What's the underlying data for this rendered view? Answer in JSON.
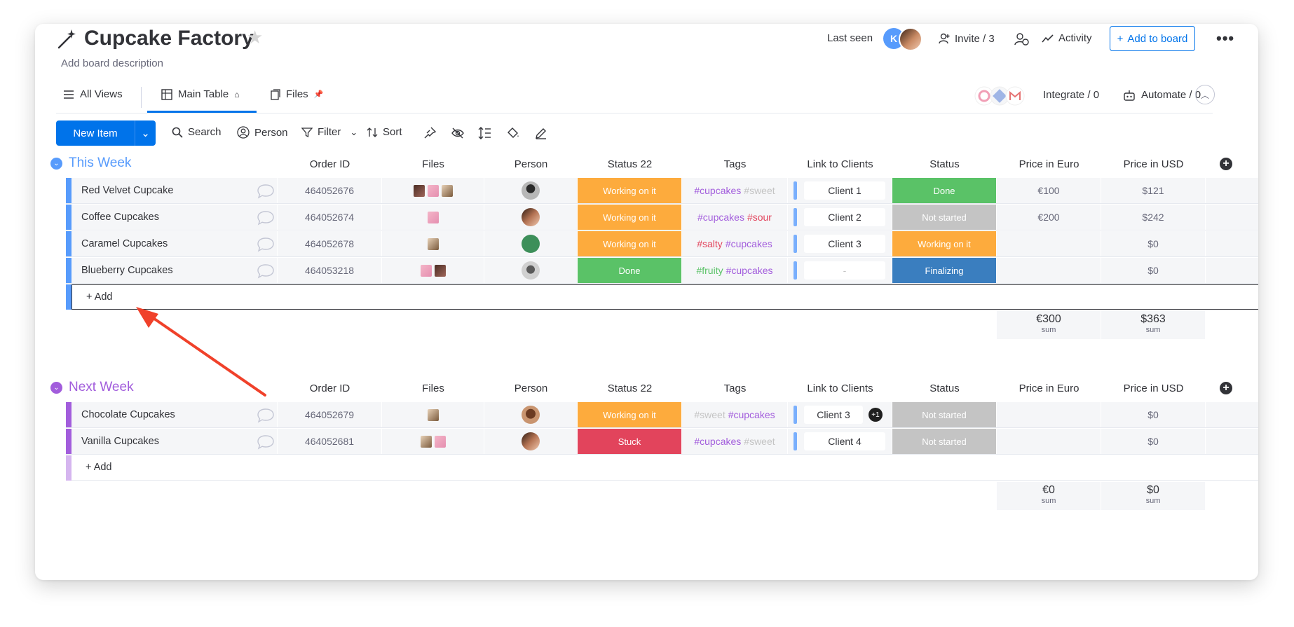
{
  "board": {
    "title": "Cupcake Factory",
    "description": "Add board description",
    "last_seen_label": "Last seen",
    "avatar_initial": "K",
    "invite_label": "Invite / 3",
    "activity_label": "Activity",
    "add_to_board_label": "Add to board"
  },
  "tabs": [
    {
      "label": "All Views"
    },
    {
      "label": "Main Table"
    },
    {
      "label": "Files"
    }
  ],
  "integrate_label": "Integrate / 0",
  "automate_label": "Automate / 0",
  "toolbar": {
    "new_item_label": "New Item",
    "search_label": "Search",
    "person_label": "Person",
    "filter_label": "Filter",
    "sort_label": "Sort"
  },
  "columns": [
    "Order ID",
    "Files",
    "Person",
    "Status 22",
    "Tags",
    "Link to Clients",
    "Status",
    "Price in Euro",
    "Price in USD"
  ],
  "groups": [
    {
      "title": "This Week",
      "color": "#579bfc",
      "add_label": "+ Add",
      "sum_euro": "€300",
      "sum_usd": "$363",
      "sum_label": "sum",
      "rows": [
        {
          "name": "Red Velvet Cupcake",
          "order_id": "464052676",
          "status22": "Working on it",
          "status22_color": "#fdab3d",
          "tags": [
            {
              "text": "#cupcakes",
              "color": "#a25ddc"
            },
            {
              "text": "#sweet",
              "color": "#c4c4c4"
            }
          ],
          "client": "Client 1",
          "status": "Done",
          "status_color": "#5ac267",
          "euro": "€100",
          "usd": "$121"
        },
        {
          "name": "Coffee Cupcakes",
          "order_id": "464052674",
          "status22": "Working on it",
          "status22_color": "#fdab3d",
          "tags": [
            {
              "text": "#cupcakes",
              "color": "#a25ddc"
            },
            {
              "text": "#sour",
              "color": "#e2445c"
            }
          ],
          "client": "Client 2",
          "status": "Not started",
          "status_color": "#c4c4c4",
          "euro": "€200",
          "usd": "$242"
        },
        {
          "name": "Caramel Cupcakes",
          "order_id": "464052678",
          "status22": "Working on it",
          "status22_color": "#fdab3d",
          "tags": [
            {
              "text": "#salty",
              "color": "#e2445c"
            },
            {
              "text": "#cupcakes",
              "color": "#a25ddc"
            }
          ],
          "client": "Client 3",
          "status": "Working on it",
          "status_color": "#fdab3d",
          "euro": "",
          "usd": "$0"
        },
        {
          "name": "Blueberry Cupcakes",
          "order_id": "464053218",
          "status22": "Done",
          "status22_color": "#5ac267",
          "tags": [
            {
              "text": "#fruity",
              "color": "#5ac267"
            },
            {
              "text": "#cupcakes",
              "color": "#a25ddc"
            }
          ],
          "client": "-",
          "status": "Finalizing",
          "status_color": "#3a7ebf",
          "euro": "",
          "usd": "$0"
        }
      ]
    },
    {
      "title": "Next Week",
      "color": "#a25ddc",
      "add_label": "+ Add",
      "sum_euro": "€0",
      "sum_usd": "$0",
      "sum_label": "sum",
      "rows": [
        {
          "name": "Chocolate Cupcakes",
          "order_id": "464052679",
          "status22": "Working on it",
          "status22_color": "#fdab3d",
          "tags": [
            {
              "text": "#sweet",
              "color": "#c4c4c4"
            },
            {
              "text": "#cupcakes",
              "color": "#a25ddc"
            }
          ],
          "client": "Client 3",
          "client_extra": "+1",
          "status": "Not started",
          "status_color": "#c4c4c4",
          "euro": "",
          "usd": "$0"
        },
        {
          "name": "Vanilla Cupcakes",
          "order_id": "464052681",
          "status22": "Stuck",
          "status22_color": "#e2445c",
          "tags": [
            {
              "text": "#cupcakes",
              "color": "#a25ddc"
            },
            {
              "text": "#sweet",
              "color": "#c4c4c4"
            }
          ],
          "client": "Client 4",
          "status": "Not started",
          "status_color": "#c4c4c4",
          "euro": "",
          "usd": "$0"
        }
      ]
    }
  ]
}
